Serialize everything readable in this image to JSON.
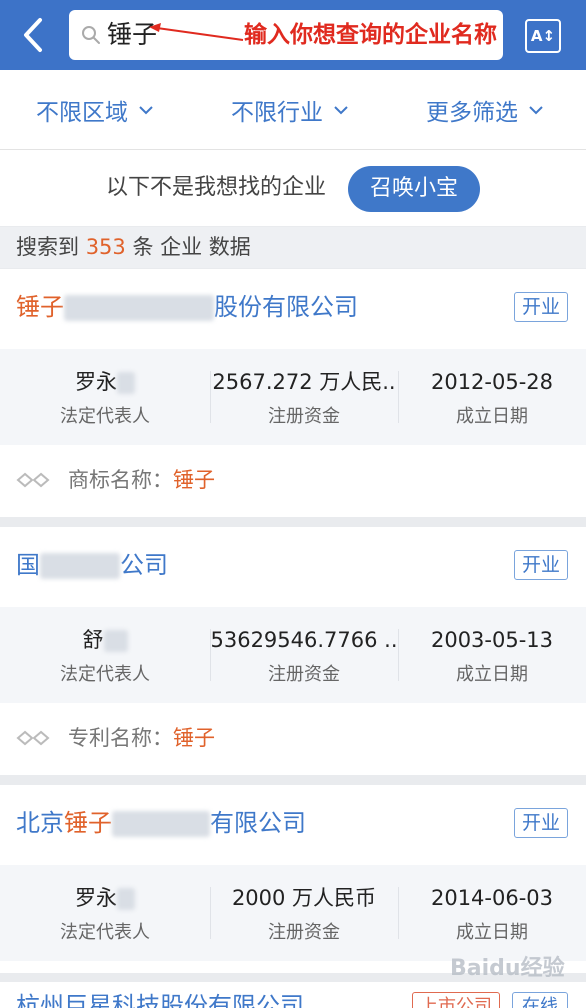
{
  "header": {
    "search_value": "锤子",
    "annotation": "输入你想查询的企业名称",
    "sort_label": "A↕"
  },
  "filters": [
    {
      "label": "不限区域"
    },
    {
      "label": "不限行业"
    },
    {
      "label": "更多筛选"
    }
  ],
  "hint": {
    "text": "以下不是我想找的企业",
    "button": "召唤小宝"
  },
  "result": {
    "prefix": "搜索到 ",
    "count": "353",
    "suffix": " 条 企业 数据"
  },
  "cards": [
    {
      "title_hl": "锤子",
      "title_end": "股份有限公司",
      "status": "开业",
      "legal_rep": "罗永",
      "capital": "2567.272 万人民..",
      "date": "2012-05-28",
      "match_label": "商标名称：",
      "match_value": "锤子"
    },
    {
      "title_start": "国",
      "title_end": "公司",
      "status": "开业",
      "legal_rep": "舒",
      "capital": "53629546.7766 ..",
      "date": "2003-05-13",
      "match_label": "专利名称：",
      "match_value": "锤子"
    },
    {
      "title_start": "北京",
      "title_hl": "锤子",
      "title_end": "有限公司",
      "status": "开业",
      "legal_rep": "罗永",
      "capital": "2000 万人民币",
      "date": "2014-06-03"
    }
  ],
  "labels": {
    "legal_rep": "法定代表人",
    "capital": "注册资金",
    "date": "成立日期"
  },
  "partial": {
    "title": "杭州巨星科技股份有限公司",
    "badge1": "上市公司",
    "badge2": "在线"
  },
  "watermark": "Baidu经验",
  "colors": {
    "brand_blue": "#3d73c8",
    "link_blue": "#3f78c9",
    "highlight": "#e0622b",
    "annotation_red": "#e02a1f"
  }
}
